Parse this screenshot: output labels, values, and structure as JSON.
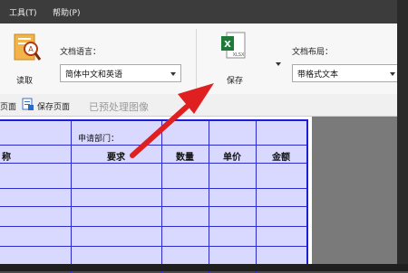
{
  "menu": {
    "tools": "工具(T)",
    "help": "帮助(P)"
  },
  "ribbon": {
    "read_label": "读取",
    "doc_language_label": "文档语言：",
    "doc_language_value": "简体中文和英语",
    "save_label": "保存",
    "excel_icon_caption": "XLSX",
    "doc_layout_label": "文档布局：",
    "doc_layout_value": "带格式文本"
  },
  "toolbar2": {
    "partial_label": "页面",
    "save_page_label": "保存页面",
    "preprocess_label": "已预处理图像"
  },
  "sheet": {
    "dept_label": "申请部门：",
    "headers": [
      "称",
      "要求",
      "数量",
      "单价",
      "金额"
    ]
  },
  "colors": {
    "arrow": "#e02020",
    "table_line": "#2b2bd1",
    "table_fill": "#d9d9ff"
  }
}
